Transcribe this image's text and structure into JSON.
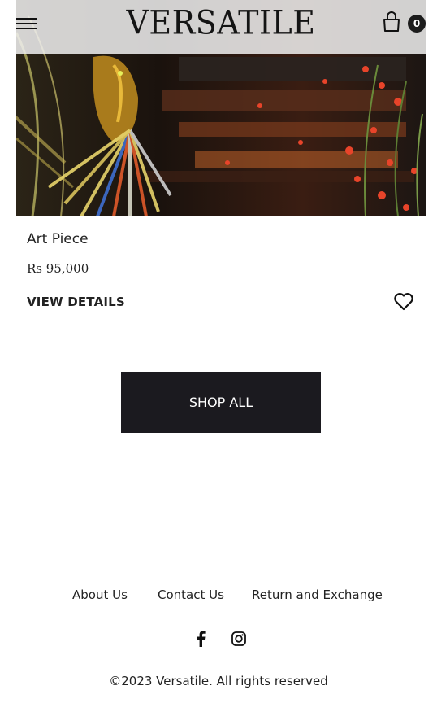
{
  "header": {
    "logo_text": "VERSATILE",
    "cart_count": "0",
    "menu_icon": "hamburger-menu-icon",
    "cart_icon": "shopping-bag-icon"
  },
  "product": {
    "name": "Art Piece",
    "price": "Rs 95,000",
    "view_details_label": "VIEW DETAILS",
    "wishlist_icon": "heart-outline-icon"
  },
  "shop_all_label": "SHOP ALL",
  "footer": {
    "links": [
      "About Us",
      "Contact Us",
      "Return and Exchange"
    ],
    "social_icons": [
      "facebook-icon",
      "instagram-icon"
    ],
    "copyright": "©2023 Versatile. All rights reserved"
  },
  "colors": {
    "button_bg": "#1b1a1f",
    "text": "#222222",
    "header_overlay": "#f0f0f0"
  }
}
